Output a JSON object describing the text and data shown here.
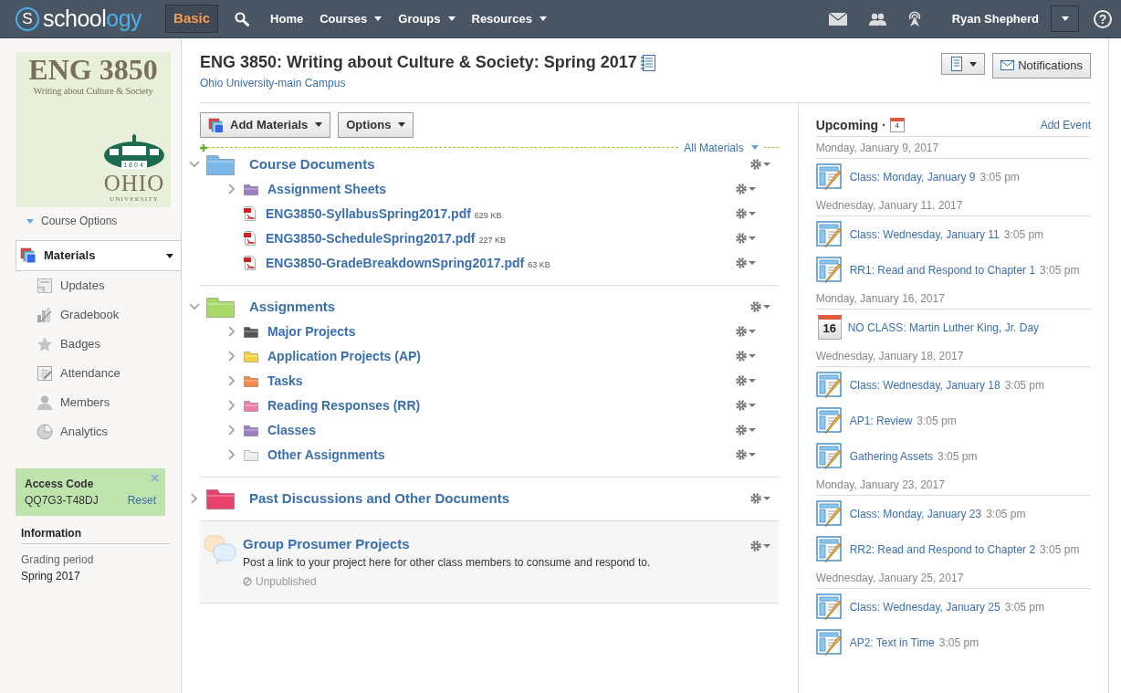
{
  "header": {
    "logo_mark": "S",
    "logo_parts": [
      "school",
      "ogy"
    ],
    "plan_badge": "Basic",
    "nav": [
      {
        "label": "Home",
        "dropdown": false
      },
      {
        "label": "Courses",
        "dropdown": true
      },
      {
        "label": "Groups",
        "dropdown": true
      },
      {
        "label": "Resources",
        "dropdown": true
      }
    ],
    "user_name": "Ryan Shepherd",
    "help": "?"
  },
  "course_image": {
    "code": "ENG 3850",
    "subtitle": "Writing about Culture & Society",
    "year": "1804",
    "school": "OHIO",
    "school_sub": "UNIVERSITY"
  },
  "sidebar": {
    "course_options": "Course Options",
    "items": [
      {
        "label": "Materials",
        "kind": "materials",
        "selected": true
      },
      {
        "label": "Updates",
        "kind": "updates",
        "selected": false
      },
      {
        "label": "Gradebook",
        "kind": "gradebook",
        "selected": false
      },
      {
        "label": "Badges",
        "kind": "badges",
        "selected": false
      },
      {
        "label": "Attendance",
        "kind": "attendance",
        "selected": false
      },
      {
        "label": "Members",
        "kind": "members",
        "selected": false
      },
      {
        "label": "Analytics",
        "kind": "analytics",
        "selected": false
      }
    ],
    "access_code": {
      "title": "Access Code",
      "code": "QQ7G3-T48DJ",
      "reset": "Reset"
    },
    "information": {
      "heading": "Information",
      "label": "Grading period",
      "value": "Spring 2017"
    }
  },
  "course": {
    "title": "ENG 3850: Writing about Culture & Society: Spring 2017",
    "campus": "Ohio University-main Campus",
    "notifications": "Notifications"
  },
  "toolbar": {
    "add_materials": "Add Materials",
    "options": "Options",
    "filter": "All Materials"
  },
  "materials": [
    {
      "kind": "folder",
      "title": "Course Documents",
      "color": "#7ab8e8",
      "expanded": true,
      "children": [
        {
          "kind": "folder",
          "title": "Assignment Sheets",
          "color": "#9b7fc0",
          "expanded": false
        },
        {
          "kind": "file",
          "title": "ENG3850-SyllabusSpring2017.pdf",
          "size": "629 KB"
        },
        {
          "kind": "file",
          "title": "ENG3850-ScheduleSpring2017.pdf",
          "size": "227 KB"
        },
        {
          "kind": "file",
          "title": "ENG3850-GradeBreakdownSpring2017.pdf",
          "size": "63 KB"
        }
      ]
    },
    {
      "kind": "folder",
      "title": "Assignments",
      "color": "#a8d86a",
      "expanded": true,
      "children": [
        {
          "kind": "folder",
          "title": "Major Projects",
          "color": "#555555",
          "expanded": false
        },
        {
          "kind": "folder",
          "title": "Application Projects (AP)",
          "color": "#f5d040",
          "expanded": false
        },
        {
          "kind": "folder",
          "title": "Tasks",
          "color": "#f5894a",
          "expanded": false
        },
        {
          "kind": "folder",
          "title": "Reading Responses (RR)",
          "color": "#f07fb0",
          "expanded": false
        },
        {
          "kind": "folder",
          "title": "Classes",
          "color": "#9b7fc0",
          "expanded": false
        },
        {
          "kind": "folder",
          "title": "Other Assignments",
          "color": "#eeeeee",
          "expanded": false
        }
      ]
    },
    {
      "kind": "folder",
      "title": "Past Discussions and Other Documents",
      "color": "#e8426c",
      "expanded": false
    },
    {
      "kind": "discussion",
      "title": "Group Prosumer Projects",
      "description": "Post a link to your project here for other class members to consume and respond to.",
      "status": "Unpublished"
    }
  ],
  "upcoming": {
    "title": "Upcoming ·",
    "calendar_day": "4",
    "add_event": "Add Event",
    "days": [
      {
        "date": "Monday, January 9, 2017",
        "events": [
          {
            "kind": "assignment",
            "title": "Class: Monday, January 9",
            "time": "3:05 pm"
          }
        ]
      },
      {
        "date": "Wednesday, January 11, 2017",
        "events": [
          {
            "kind": "assignment",
            "title": "Class: Wednesday, January 11",
            "time": "3:05 pm"
          },
          {
            "kind": "assignment",
            "title": "RR1: Read and Respond to Chapter 1",
            "time": "3:05 pm"
          }
        ]
      },
      {
        "date": "Monday, January 16, 2017",
        "events": [
          {
            "kind": "event",
            "title": "NO CLASS: Martin Luther King, Jr. Day",
            "day": "16"
          }
        ]
      },
      {
        "date": "Wednesday, January 18, 2017",
        "events": [
          {
            "kind": "assignment",
            "title": "Class: Wednesday, January 18",
            "time": "3:05 pm"
          },
          {
            "kind": "assignment",
            "title": "AP1: Review",
            "time": "3:05 pm"
          },
          {
            "kind": "assignment",
            "title": "Gathering Assets",
            "time": "3:05 pm"
          }
        ]
      },
      {
        "date": "Monday, January 23, 2017",
        "events": [
          {
            "kind": "assignment",
            "title": "Class: Monday, January 23",
            "time": "3:05 pm"
          },
          {
            "kind": "assignment",
            "title": "RR2: Read and Respond to Chapter 2",
            "time": "3:05 pm"
          }
        ]
      },
      {
        "date": "Wednesday, January 25, 2017",
        "events": [
          {
            "kind": "assignment",
            "title": "Class: Wednesday, January 25",
            "time": "3:05 pm"
          },
          {
            "kind": "assignment",
            "title": "AP2: Text in Time",
            "time": "3:05 pm"
          }
        ]
      }
    ]
  }
}
